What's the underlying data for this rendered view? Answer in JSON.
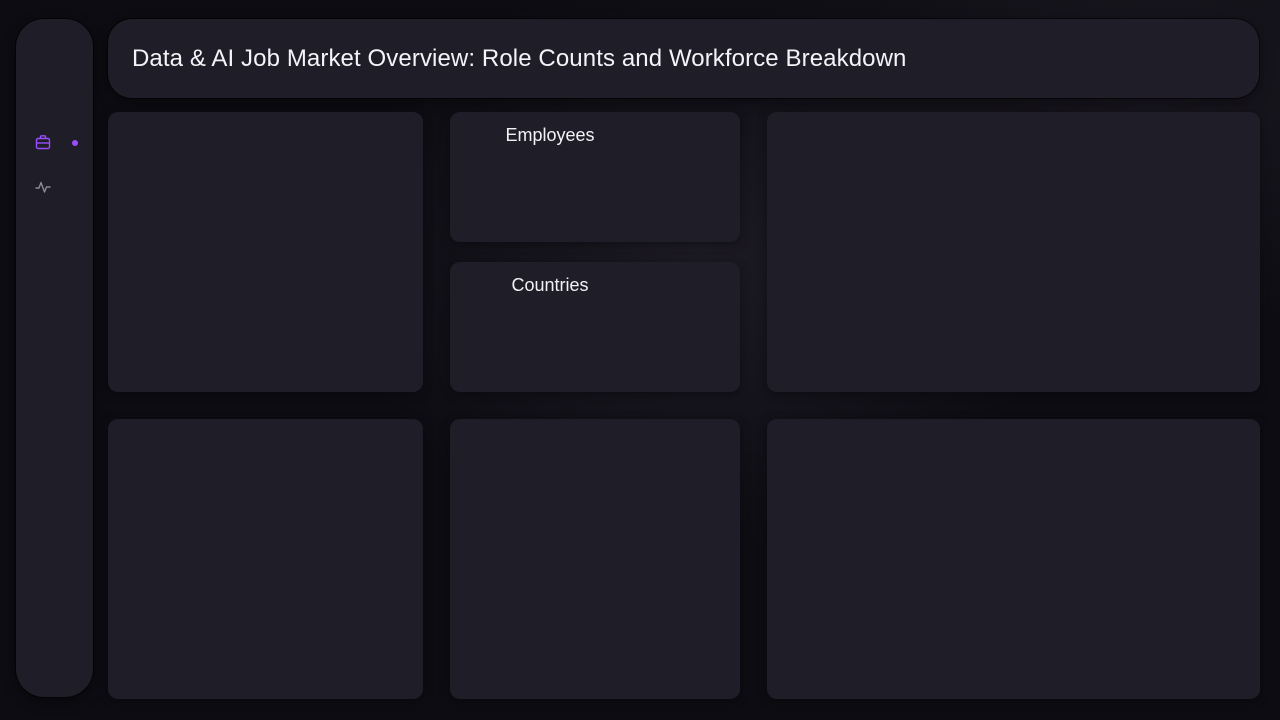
{
  "header": {
    "title": "Data & AI Job Market Overview: Role Counts and Workforce Breakdown"
  },
  "sidebar": {
    "items": [
      {
        "icon": "briefcase-icon",
        "active": true
      },
      {
        "icon": "activity-icon",
        "active": false
      }
    ],
    "accent_color": "#9b4dff"
  },
  "kpis": {
    "employees_label": "Employees",
    "countries_label": "Countries"
  },
  "colors": {
    "background": "#0d0c12",
    "panel": "#1f1d27",
    "text": "#f2f1f6",
    "icon_inactive": "#8c8a96"
  }
}
